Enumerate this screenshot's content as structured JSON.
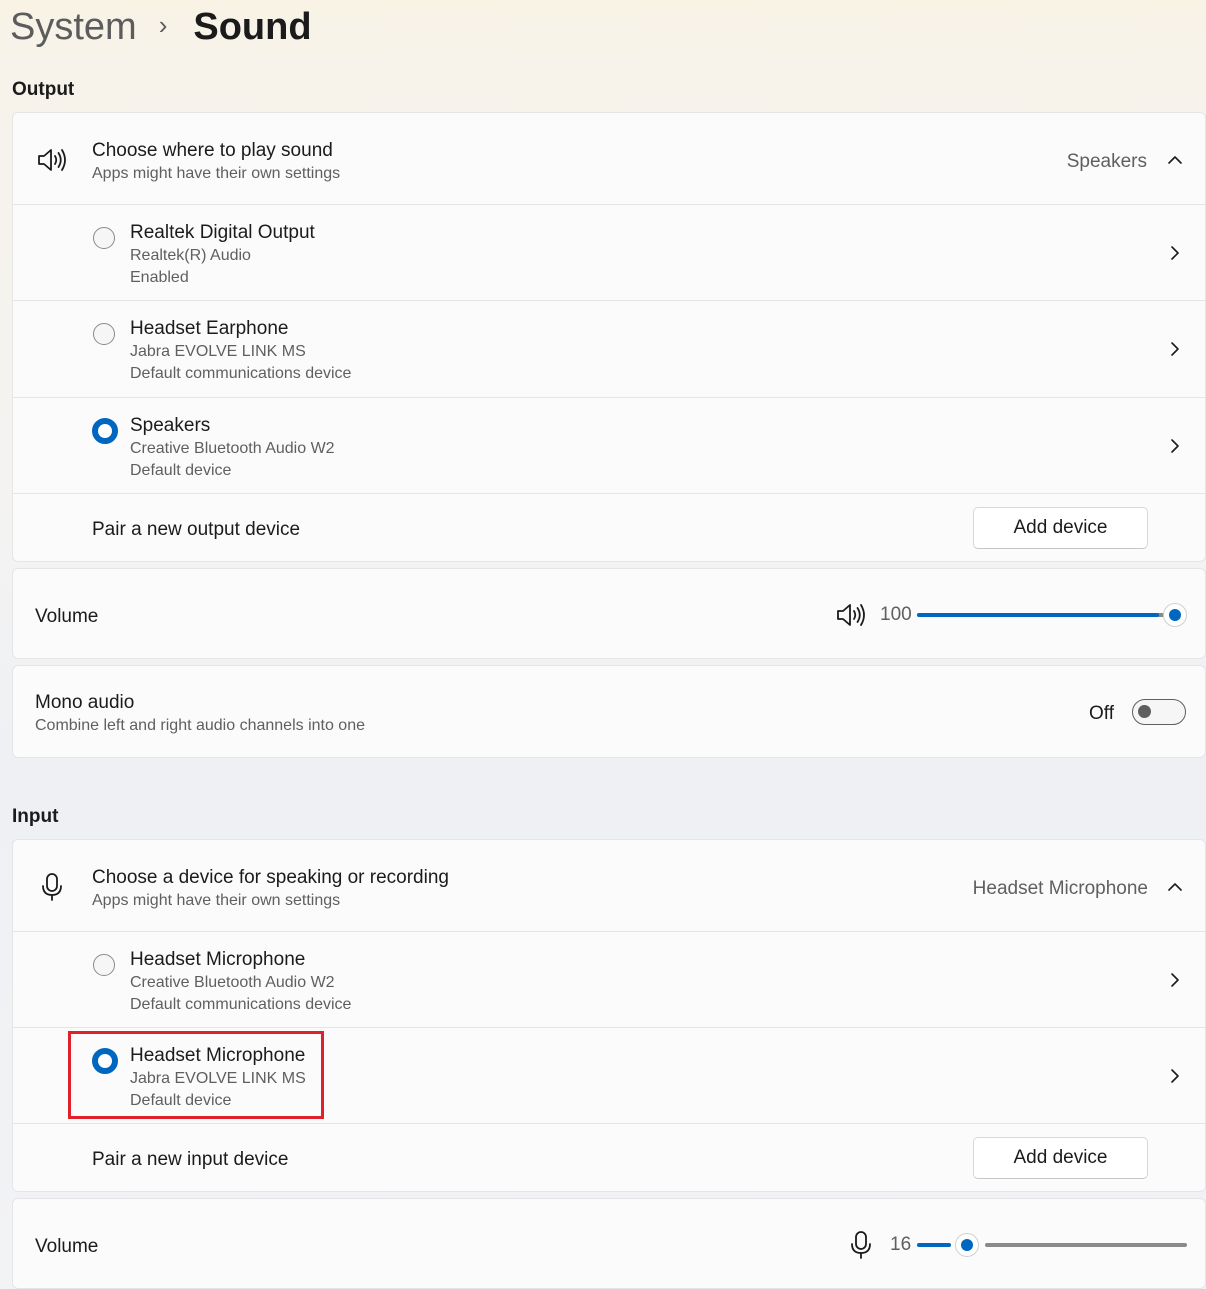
{
  "breadcrumb": {
    "parent": "System",
    "separator": "›",
    "current": "Sound"
  },
  "output": {
    "section_label": "Output",
    "chooser": {
      "title": "Choose where to play sound",
      "subtitle": "Apps might have their own settings",
      "selected_value": "Speakers",
      "icon": "speaker-icon"
    },
    "devices": [
      {
        "name": "Realtek Digital Output",
        "driver": "Realtek(R) Audio",
        "status": "Enabled",
        "selected": false
      },
      {
        "name": "Headset Earphone",
        "driver": "Jabra EVOLVE LINK MS",
        "status": "Default communications device",
        "selected": false
      },
      {
        "name": "Speakers",
        "driver": "Creative Bluetooth Audio W2",
        "status": "Default device",
        "selected": true
      }
    ],
    "pair": {
      "label": "Pair a new output device",
      "button": "Add device"
    },
    "volume": {
      "label": "Volume",
      "value": "100",
      "level": 1.0,
      "icon": "speaker-icon"
    },
    "mono": {
      "title": "Mono audio",
      "subtitle": "Combine left and right audio channels into one",
      "state": "Off",
      "on": false
    }
  },
  "input": {
    "section_label": "Input",
    "chooser": {
      "title": "Choose a device for speaking or recording",
      "subtitle": "Apps might have their own settings",
      "selected_value": "Headset Microphone",
      "icon": "microphone-icon"
    },
    "devices": [
      {
        "name": "Headset Microphone",
        "driver": "Creative Bluetooth Audio W2",
        "status": "Default communications device",
        "selected": false
      },
      {
        "name": "Headset Microphone",
        "driver": "Jabra EVOLVE LINK MS",
        "status": "Default device",
        "selected": true,
        "highlighted": true
      }
    ],
    "pair": {
      "label": "Pair a new input device",
      "button": "Add device"
    },
    "volume": {
      "label": "Volume",
      "value": "16",
      "level": 0.16,
      "icon": "microphone-icon"
    }
  },
  "colors": {
    "accent": "#0067c0",
    "highlight": "#e0202b"
  }
}
